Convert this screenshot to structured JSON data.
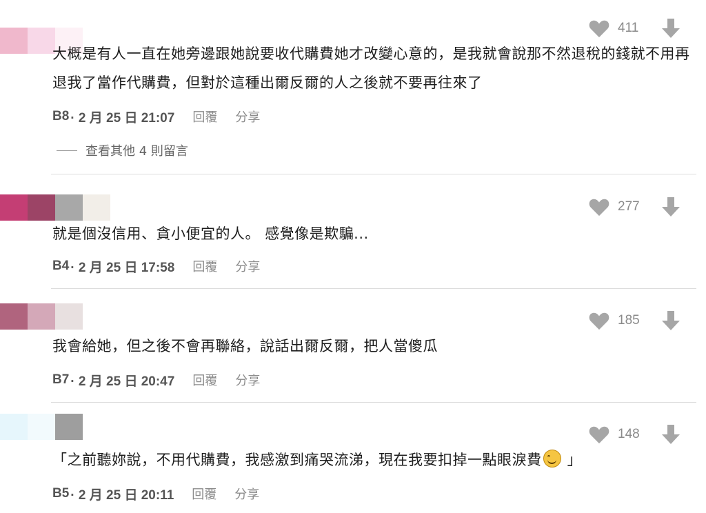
{
  "comments": [
    {
      "likes": "411",
      "text": "大概是有人一直在她旁邊跟她說要收代購費她才改變心意的，是我就會說那不然退稅的錢就不用再退我了當作代購費，但對於這種出爾反爾的人之後就不要再往來了",
      "floor": "B8",
      "date": "· 2 月 25 日 21:07",
      "reply_label": "回覆",
      "share_label": "分享",
      "more_replies": "查看其他 4 則留言",
      "avatar_colors": [
        "#f0b8cc",
        "#f8d8e8",
        "#fbe8f0"
      ]
    },
    {
      "likes": "277",
      "text": "就是個沒信用、貪小便宜的人。 感覺像是欺騙...",
      "floor": "B4",
      "date": "· 2 月 25 日 17:58",
      "reply_label": "回覆",
      "share_label": "分享",
      "avatar_colors": [
        "#c43e74",
        "#9c4466",
        "#a8a8a8",
        "#f2eee8"
      ]
    },
    {
      "likes": "185",
      "text": "我會給她，但之後不會再聯絡，說話出爾反爾，把人當傻瓜",
      "floor": "B7",
      "date": "· 2 月 25 日 20:47",
      "reply_label": "回覆",
      "share_label": "分享",
      "avatar_colors": [
        "#b0647e",
        "#d4a8b8",
        "#e8e0e0"
      ]
    },
    {
      "likes": "148",
      "text_before": "「之前聽妳說，不用代購費，我感激到痛哭流涕，現在我要扣掉一點眼淚費",
      "emoji": "smiling-face-emoji",
      "text_after": " 」",
      "floor": "B5",
      "date": "· 2 月 25 日 20:11",
      "reply_label": "回覆",
      "share_label": "分享",
      "avatar_colors": [
        "#e6f6fc",
        "#f2fafd",
        "#9e9e9e"
      ]
    }
  ],
  "icons": {
    "like": "heart-icon",
    "downvote": "down-arrow-icon"
  },
  "colors": {
    "icon_gray": "#a6a6a6",
    "divider": "#dcdcdc"
  }
}
